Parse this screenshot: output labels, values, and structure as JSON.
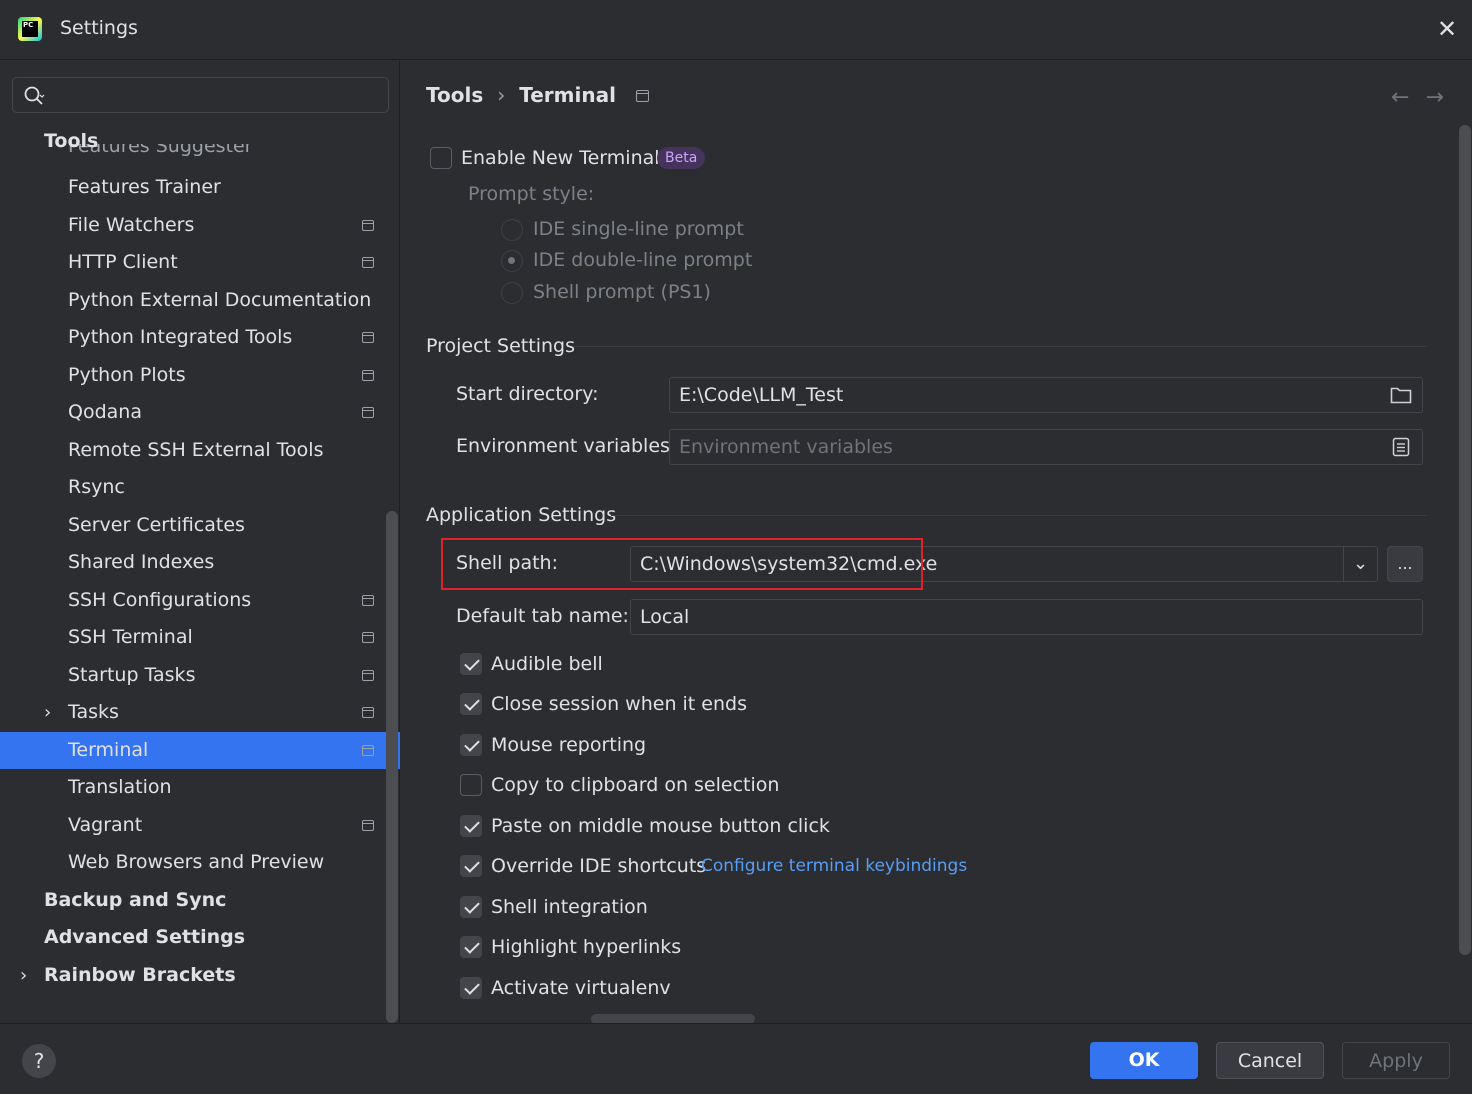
{
  "window": {
    "title": "Settings",
    "logo_text": "PC"
  },
  "sidebar": {
    "search_placeholder": "",
    "clipped_item": "Features Suggester",
    "items": [
      {
        "label": "Tools",
        "level": 1
      },
      {
        "label": "Features Trainer",
        "level": 2
      },
      {
        "label": "File Watchers",
        "level": 2
      },
      {
        "label": "HTTP Client",
        "level": 2
      },
      {
        "label": "Python External Documentation",
        "level": 2
      },
      {
        "label": "Python Integrated Tools",
        "level": 2
      },
      {
        "label": "Python Plots",
        "level": 2
      },
      {
        "label": "Qodana",
        "level": 2
      },
      {
        "label": "Remote SSH External Tools",
        "level": 2
      },
      {
        "label": "Rsync",
        "level": 2
      },
      {
        "label": "Server Certificates",
        "level": 2
      },
      {
        "label": "Shared Indexes",
        "level": 2
      },
      {
        "label": "SSH Configurations",
        "level": 2
      },
      {
        "label": "SSH Terminal",
        "level": 2
      },
      {
        "label": "Startup Tasks",
        "level": 2
      },
      {
        "label": "Tasks",
        "level": 2
      },
      {
        "label": "Terminal",
        "level": 2,
        "selected": true
      },
      {
        "label": "Translation",
        "level": 2
      },
      {
        "label": "Vagrant",
        "level": 2
      },
      {
        "label": "Web Browsers and Preview",
        "level": 2
      },
      {
        "label": "Backup and Sync",
        "level": 1
      },
      {
        "label": "Advanced Settings",
        "level": 1
      },
      {
        "label": "Rainbow Brackets",
        "level": 1
      }
    ]
  },
  "breadcrumb": {
    "parent": "Tools",
    "separator": "›",
    "current": "Terminal"
  },
  "nav": {
    "back": "←",
    "forward": "→"
  },
  "new_terminal": {
    "label": "Enable New Terminal",
    "badge": "Beta",
    "prompt_style_label": "Prompt style:",
    "options": [
      "IDE single-line prompt",
      "IDE double-line prompt",
      "Shell prompt (PS1)"
    ],
    "selected_option": "IDE double-line prompt"
  },
  "project_settings": {
    "title": "Project Settings",
    "start_directory_label": "Start directory:",
    "start_directory_value": "E:\\Code\\LLM_Test",
    "env_vars_label": "Environment variables:",
    "env_vars_placeholder": "Environment variables"
  },
  "app_settings": {
    "title": "Application Settings",
    "shell_path_label": "Shell path:",
    "shell_path_value": "C:\\Windows\\system32\\cmd.exe",
    "browse_label": "...",
    "default_tab_label": "Default tab name:",
    "default_tab_value": "Local",
    "keybindings_link": "Configure terminal keybindings",
    "options": [
      {
        "label": "Audible bell",
        "checked": true
      },
      {
        "label": "Close session when it ends",
        "checked": true
      },
      {
        "label": "Mouse reporting",
        "checked": true
      },
      {
        "label": "Copy to clipboard on selection",
        "checked": false
      },
      {
        "label": "Paste on middle mouse button click",
        "checked": true
      },
      {
        "label": "Override IDE shortcuts",
        "checked": true
      },
      {
        "label": "Shell integration",
        "checked": true
      },
      {
        "label": "Highlight hyperlinks",
        "checked": true
      },
      {
        "label": "Activate virtualenv",
        "checked": true
      }
    ]
  },
  "footer": {
    "help": "?",
    "ok": "OK",
    "cancel": "Cancel",
    "apply": "Apply"
  },
  "colors": {
    "accent": "#3574f0",
    "highlight_border": "#e0202a",
    "link": "#589df6",
    "beta_bg": "#45335c"
  }
}
